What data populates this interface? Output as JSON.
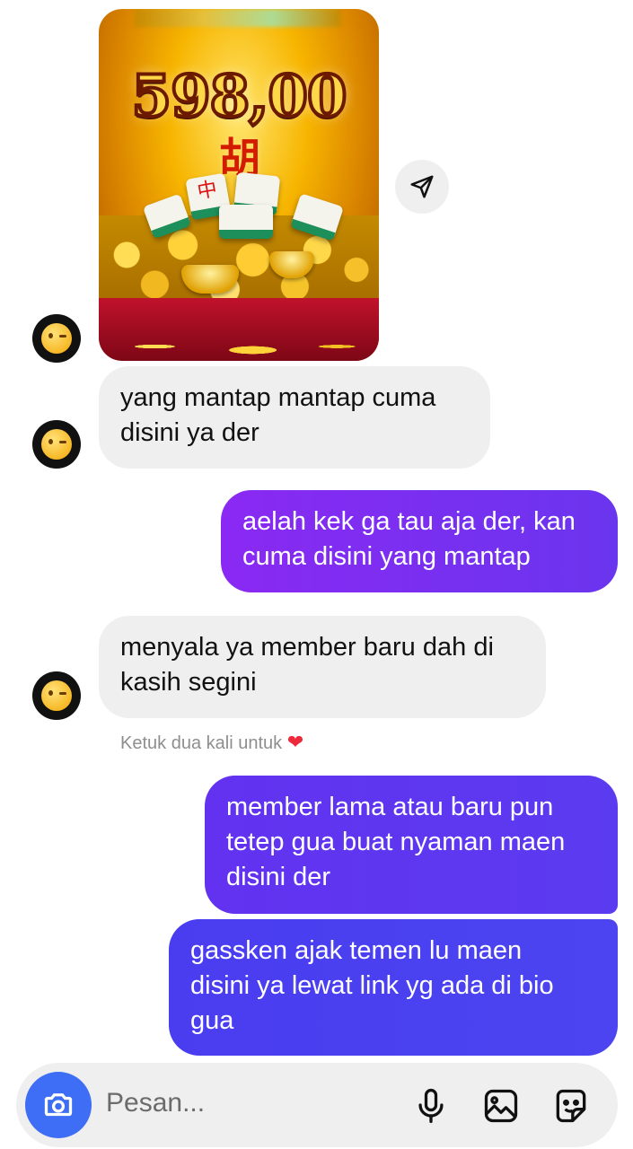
{
  "post": {
    "amount": "598,00",
    "glyph": "胡",
    "tile_glyph": "中"
  },
  "messages": [
    {
      "side": "in",
      "text": "yang mantap mantap cuma\ndisini ya der"
    },
    {
      "side": "out",
      "text": "aelah kek ga tau aja der, kan\ncuma disini yang mantap"
    },
    {
      "side": "in",
      "text": "menyala ya member baru dah di\nkasih segini"
    },
    {
      "side": "out",
      "text": "member lama atau baru pun\ntetep gua buat nyaman maen\ndisini der"
    },
    {
      "side": "out",
      "text": "gassken ajak temen lu maen\ndisini ya lewat link yg ada di  bio\ngua"
    }
  ],
  "hint": {
    "text": "Ketuk dua kali untuk",
    "icon": "heart-icon"
  },
  "composer": {
    "placeholder": "Pesan...",
    "icons": [
      "camera-icon",
      "microphone-icon",
      "gallery-icon",
      "sticker-icon"
    ]
  },
  "colors": {
    "incoming_bubble": "#efefef",
    "outgoing_gradient_1": "#7b2cf4",
    "outgoing_gradient_2": "#5a3af0",
    "camera_button": "#3d6ef5",
    "heart": "#ed2a3c"
  }
}
